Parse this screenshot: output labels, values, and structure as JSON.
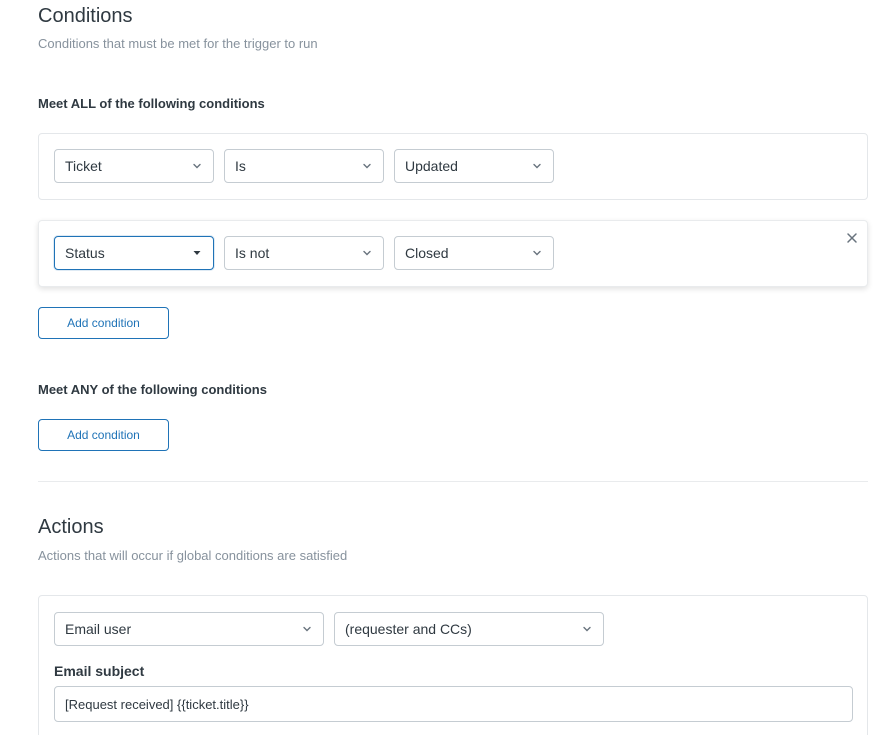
{
  "conditions": {
    "title": "Conditions",
    "subtitle": "Conditions that must be met for the trigger to run",
    "all": {
      "label": "Meet ALL of the following conditions",
      "rows": [
        {
          "field": "Ticket",
          "operator": "Is",
          "value": "Updated"
        },
        {
          "field": "Status",
          "operator": "Is not",
          "value": "Closed"
        }
      ],
      "add_label": "Add condition"
    },
    "any": {
      "label": "Meet ANY of the following conditions",
      "add_label": "Add condition"
    }
  },
  "actions": {
    "title": "Actions",
    "subtitle": "Actions that will occur if global conditions are satisfied",
    "rows": [
      {
        "action": "Email user",
        "target": "(requester and CCs)"
      }
    ],
    "email_subject_label": "Email subject",
    "email_subject_value": "[Request received] {{ticket.title}}"
  },
  "colors": {
    "accent": "#1f73b7",
    "text": "#2f3941",
    "muted": "#87929d",
    "border": "#c5ccd2"
  }
}
